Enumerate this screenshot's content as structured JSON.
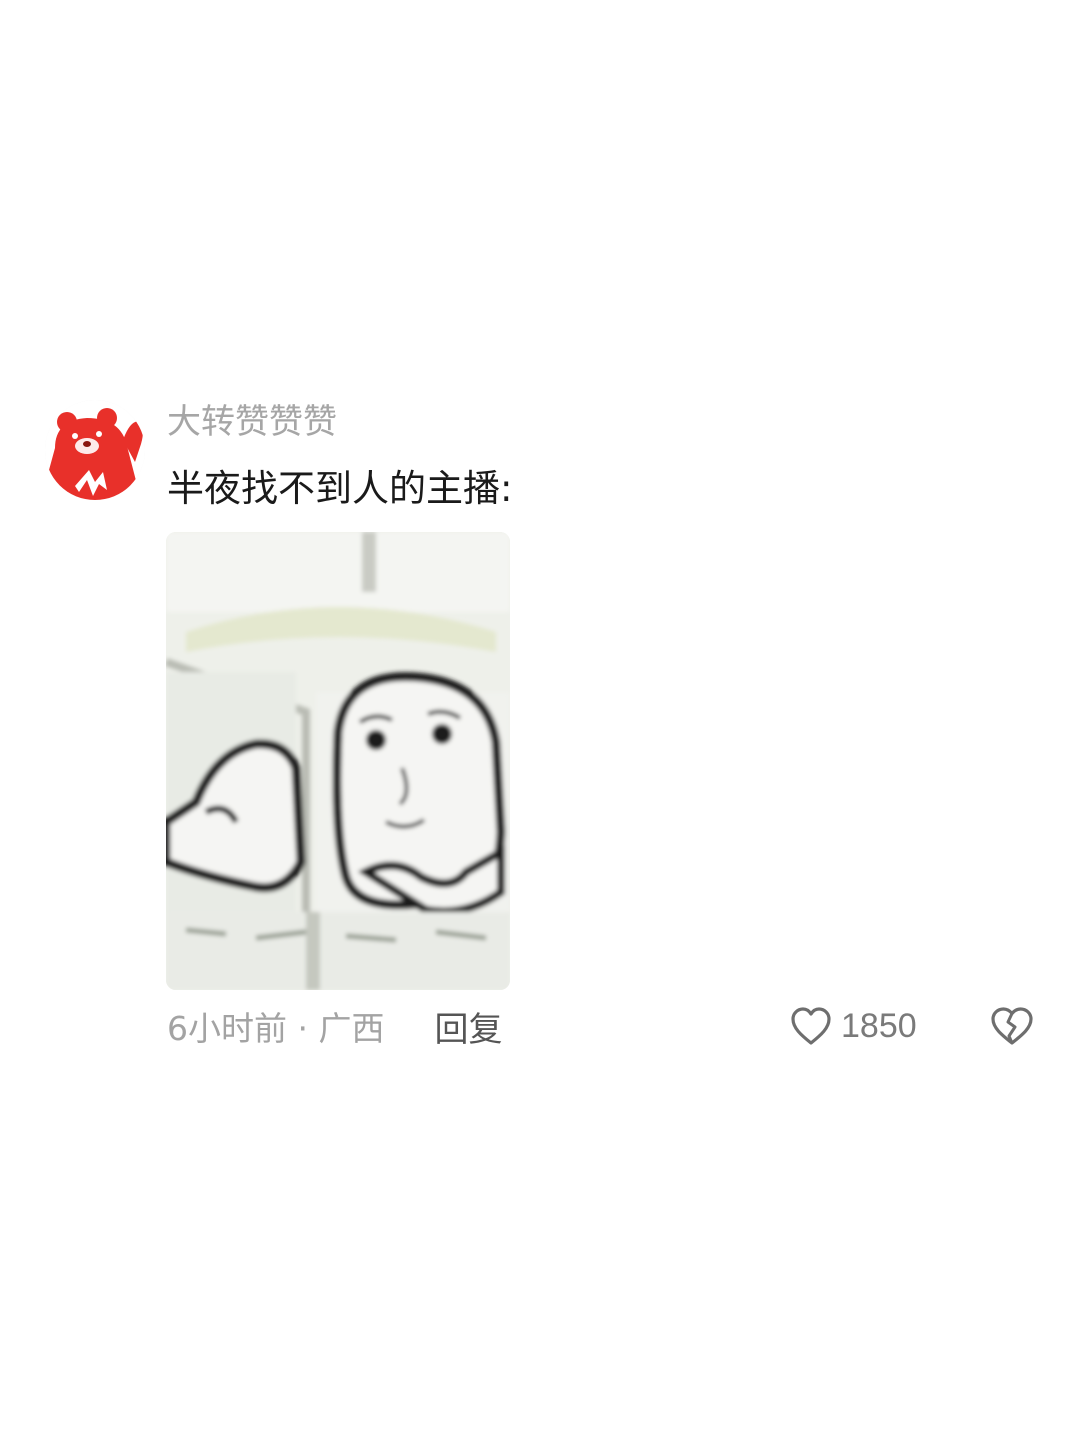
{
  "comment": {
    "author": {
      "name": "大转赞赞赞",
      "avatar_icon": "red-bear-avatar-icon",
      "avatar_color": "#e8302a"
    },
    "text": "半夜找不到人的主播:",
    "image": {
      "icon": "meme-sticker-image"
    },
    "meta": {
      "timestamp": "6小时前 · 广西",
      "reply_label": "回复"
    },
    "actions": {
      "like_icon": "heart-outline-icon",
      "like_count": "1850",
      "dislike_icon": "broken-heart-icon"
    }
  },
  "colors": {
    "background": "#ffffff",
    "username": "#a6a6a6",
    "text": "#1a1a1a",
    "meta": "#a3a3a3",
    "reply": "#555555"
  }
}
